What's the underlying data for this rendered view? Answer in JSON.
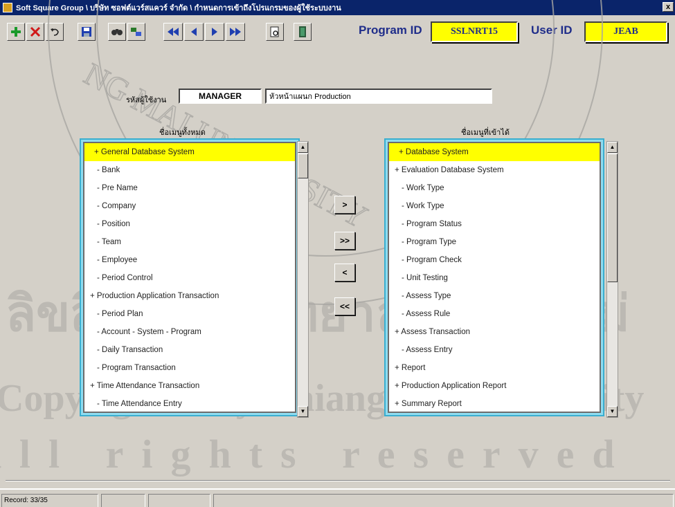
{
  "window": {
    "title": "Soft Square Group \\ บริษัท ซอฟต์แวร์สแควร์ จำกัด \\ กำหนดการเข้าถึงโปรแกรมของผู้ใช้ระบบงาน",
    "close_label": "x"
  },
  "toolbar": {
    "buttons": [
      "add-icon",
      "delete-icon",
      "undo-icon",
      "save-icon",
      "find-icon",
      "filter-icon",
      "first-record-icon",
      "previous-record-icon",
      "next-record-icon",
      "last-record-icon",
      "preview-icon",
      "exit-icon"
    ],
    "program_id_label": "Program ID",
    "program_id_value": "SSLNRT15",
    "user_id_label": "User ID",
    "user_id_value": "JEAB"
  },
  "form": {
    "user_label": "รหัสผู้ใช้งาน",
    "user_code": "MANAGER",
    "user_name": "หัวหน้าแผนก Production"
  },
  "lists": {
    "available_caption": "ชื่อเมนูทั้งหมด",
    "assigned_caption": "ชื่อเมนูที่เข้าได้",
    "available": [
      "+ General Database System",
      "- Bank",
      "- Pre Name",
      "- Company",
      "- Position",
      "- Team",
      "- Employee",
      "- Period Control",
      "+ Production Application Transaction",
      "- Period Plan",
      "- Account - System - Program",
      "- Daily Transaction",
      "- Program Transaction",
      "+ Time Attendance Transaction",
      "- Time Attendance Entry"
    ],
    "assigned": [
      "+ Database System",
      "+ Evaluation Database System",
      "- Work Type",
      "- Work Type",
      "- Program Status",
      "- Program Type",
      "- Program Check",
      "- Unit Testing",
      "- Assess Type",
      "- Assess Rule",
      "+ Assess Transaction",
      "- Assess Entry",
      "+ Report",
      "+ Production Application Report",
      "+ Summary Report"
    ]
  },
  "move_buttons": {
    "add_one": ">",
    "add_all": ">>",
    "remove_one": "<",
    "remove_all": "<<"
  },
  "status_bar": {
    "record": "Record: 33/35"
  },
  "watermark": {
    "seal_text_top": "NG MAI UNIVERSITY",
    "thai_line": "ลิขสิทธิ์มหาวิทยาลัยเชียงใหม่",
    "copyright_line": "Copyright © by Chiang Mai University",
    "rights_line": "All rights reserved"
  },
  "colors": {
    "title_bar": "#0a246a",
    "highlight": "#ffff00",
    "list_frame": "#8fdcf0",
    "label_blue": "#1f2d8a"
  }
}
